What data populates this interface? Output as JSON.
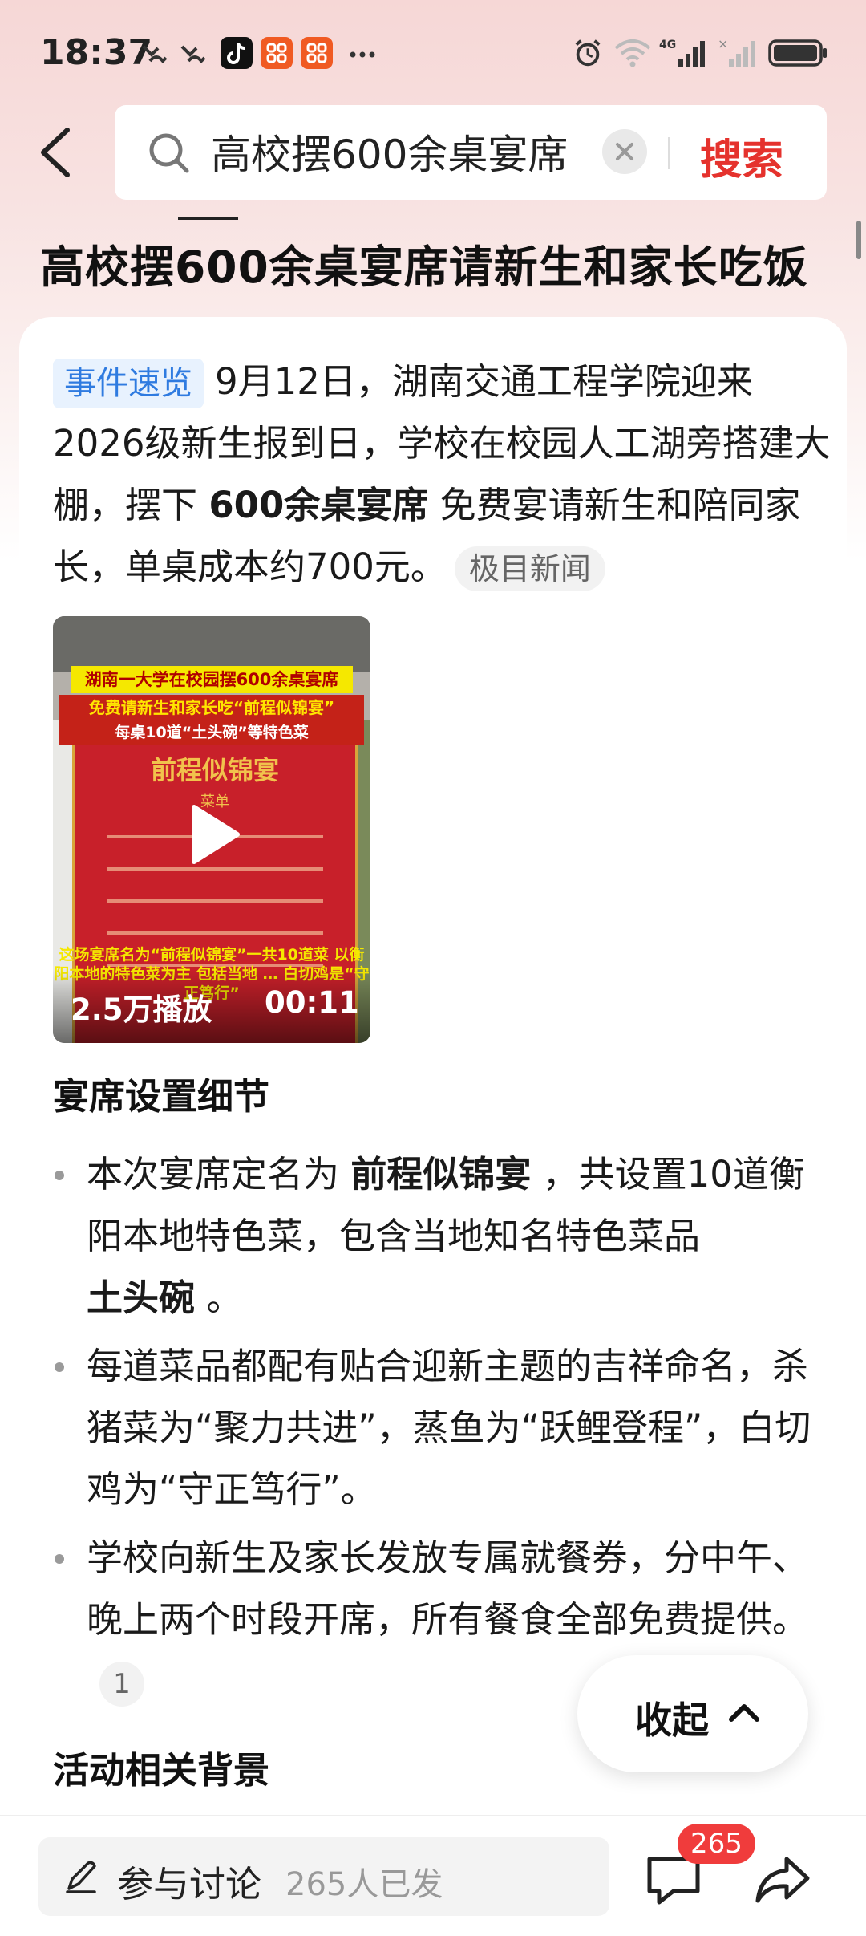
{
  "status_bar": {
    "time": "18:37"
  },
  "search": {
    "query": "高校摆600余桌宴席",
    "button_label": "搜索"
  },
  "page_title": "高校摆600余桌宴席请新生和家长吃饭",
  "summary": {
    "tag": "事件速览",
    "text_1": "9月12日，湖南交通工程学院迎来2026级新生报到日，学校在校园人工湖旁搭建大棚，摆下",
    "bold": "600余桌宴席",
    "text_2": "免费宴请新生和陪同家长，单桌成本约700元。",
    "source": "极目新闻"
  },
  "video": {
    "banner_1": "湖南一大学在校园摆600余桌宴席",
    "banner_2": "免费请新生和家长吃“前程似锦宴”",
    "banner_3": "每桌10道“土头碗”等特色菜",
    "menu_title": "前程似锦宴",
    "menu_sub": "菜单",
    "caption": "这场宴席名为“前程似锦宴”一共10道菜 以衡阳本地的特色菜为主 包括当地 … 白切鸡是“守正笃行”",
    "plays": "2.5万播放",
    "duration": "00:11"
  },
  "section_1": {
    "heading": "宴席设置细节",
    "bullets": [
      {
        "pre": "本次宴席定名为",
        "bold": "前程似锦宴",
        "post": "，共设置10道衡阳本地特色菜，包含当地知名特色菜品",
        "bold2": "土头碗",
        "post2": "。"
      },
      {
        "pre": "每道菜品都配有贴合迎新主题的吉祥命名，杀猪菜为“聚力共进”，蒸鱼为“跃鲤登程”，白切鸡为“守正笃行”。"
      },
      {
        "pre": "学校向新生及家长发放专属就餐券，分中午、晚上两个时段开席，所有餐食全部免费提供。",
        "cite": "1"
      }
    ]
  },
  "section_2": {
    "heading": "活动相关背景"
  },
  "collapse": {
    "label": "收起"
  },
  "bottom_bar": {
    "comment_label": "参与讨论",
    "comment_count": "265人已发",
    "badge": "265"
  }
}
